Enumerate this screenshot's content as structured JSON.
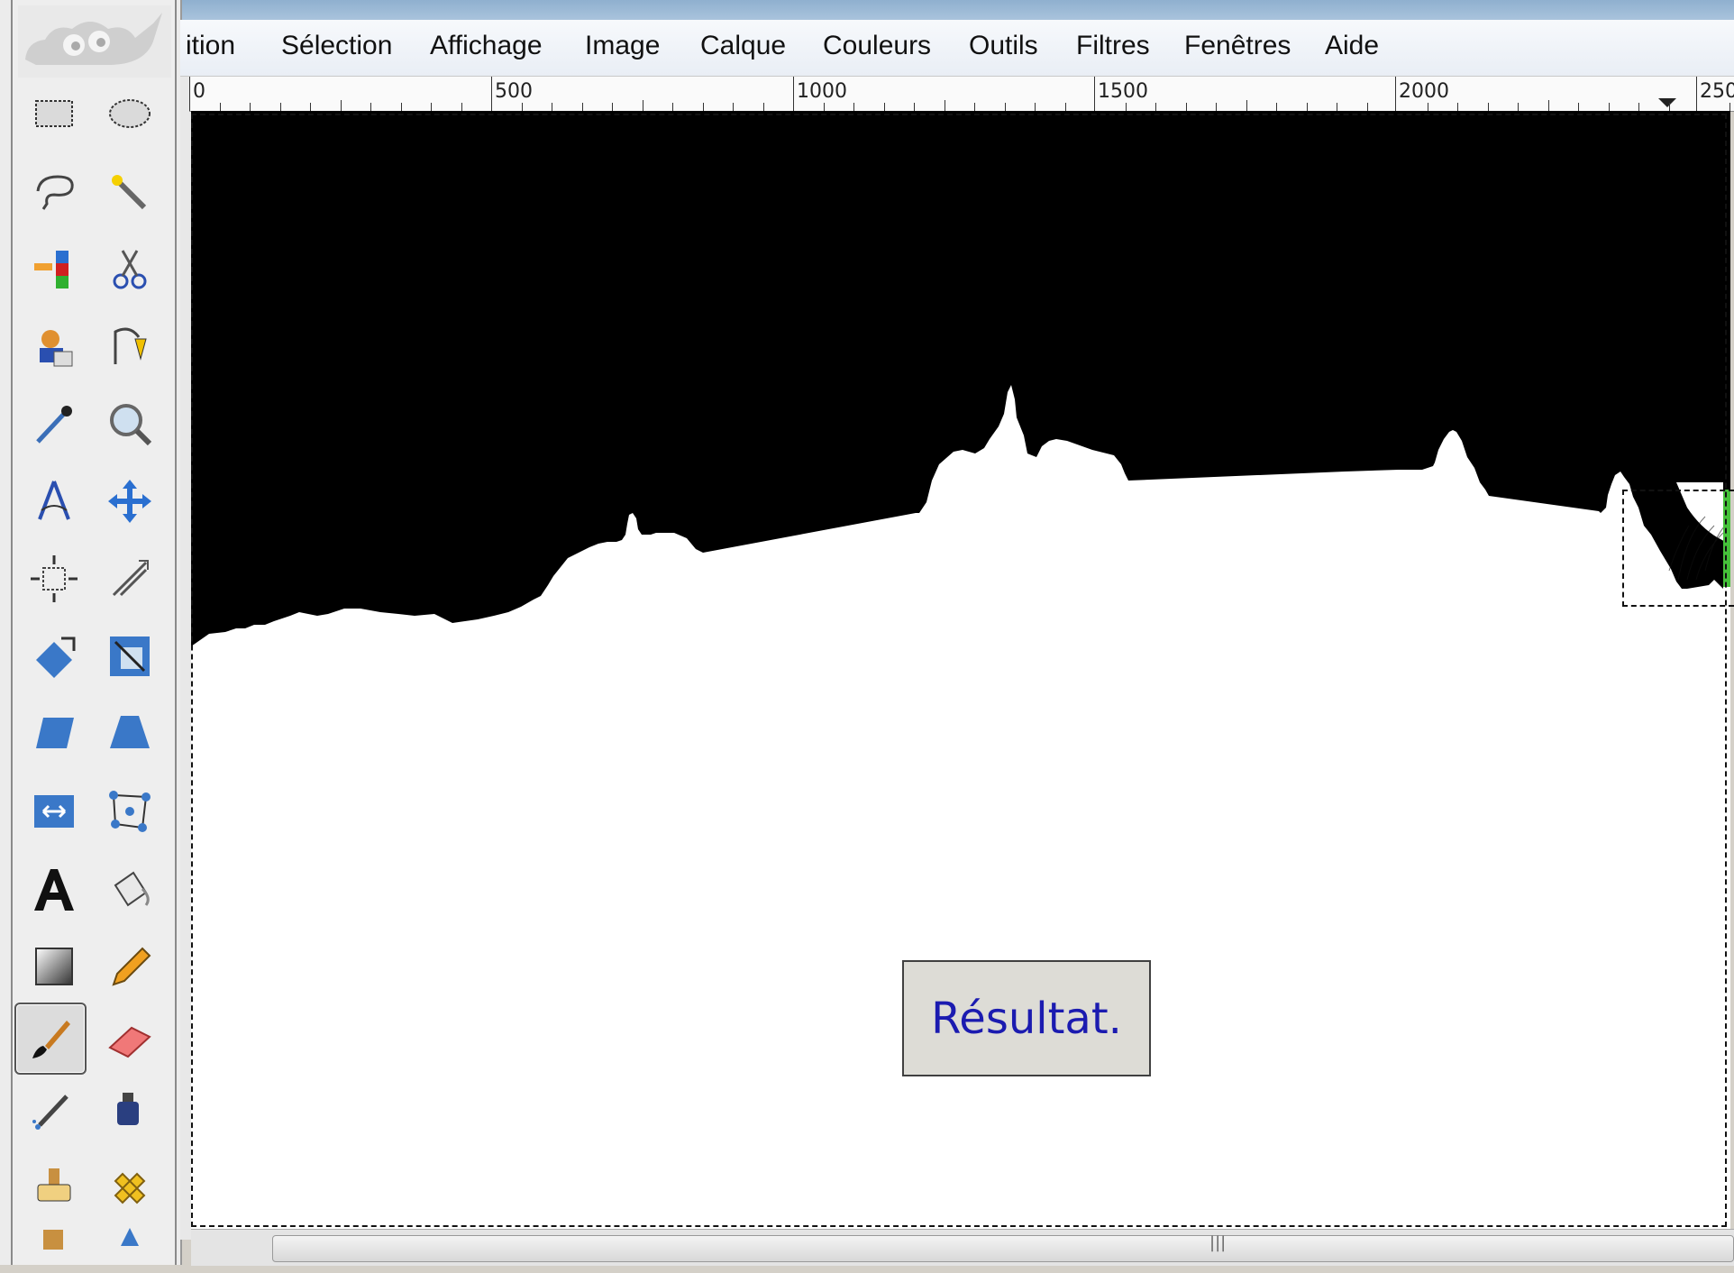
{
  "menu": {
    "items": [
      {
        "label": "ition"
      },
      {
        "label": "Sélection"
      },
      {
        "label": "Affichage"
      },
      {
        "label": "Image"
      },
      {
        "label": "Calque"
      },
      {
        "label": "Couleurs"
      },
      {
        "label": "Outils"
      },
      {
        "label": "Filtres"
      },
      {
        "label": "Fenêtres"
      },
      {
        "label": "Aide"
      }
    ]
  },
  "ruler": {
    "labels": [
      "0",
      "500",
      "1000",
      "1500",
      "2000",
      "250"
    ]
  },
  "canvas": {
    "result_button": "Résultat."
  },
  "toolbox": {
    "tools": [
      "rect-select-icon",
      "ellipse-select-icon",
      "free-select-icon",
      "fuzzy-select-icon",
      "select-by-color-icon",
      "scissors-select-icon",
      "foreground-select-icon",
      "paths-icon",
      "color-picker-icon",
      "zoom-icon",
      "measure-icon",
      "move-icon",
      "align-icon",
      "crop-icon",
      "rotate-icon",
      "scale-icon",
      "shear-icon",
      "perspective-icon",
      "flip-icon",
      "cage-transform-icon",
      "text-icon",
      "bucket-fill-icon",
      "blend-icon",
      "pencil-icon",
      "paintbrush-icon",
      "eraser-icon",
      "airbrush-icon",
      "ink-icon",
      "clone-icon",
      "heal-icon",
      "perspective-clone-icon",
      "blur-sharpen-icon"
    ],
    "active_tool": "paintbrush-icon"
  },
  "colors": {
    "canvas_top": "#000000",
    "canvas_bottom": "#ffffff",
    "button_text": "#1b1bb0"
  }
}
